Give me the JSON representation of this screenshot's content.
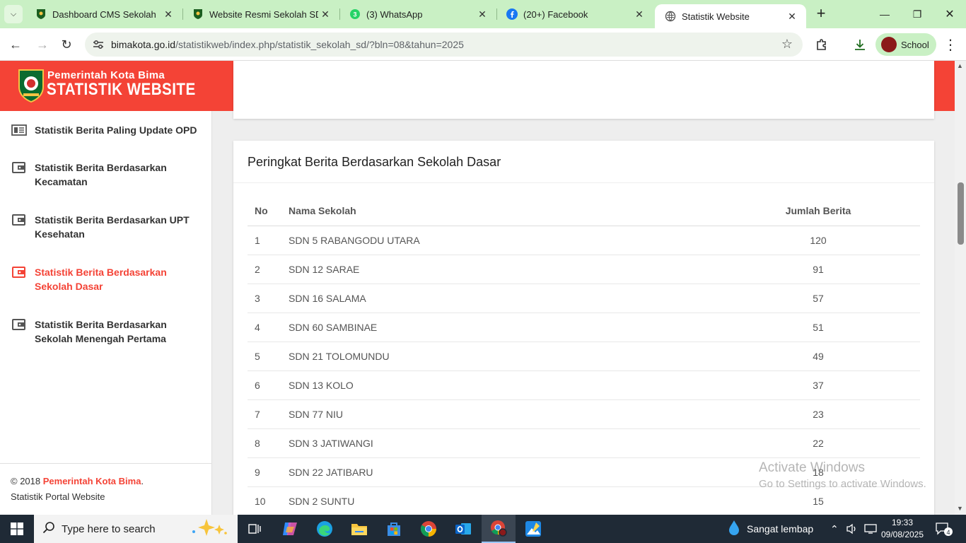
{
  "browser": {
    "tabs": [
      {
        "title": "Dashboard CMS Sekolah",
        "icon": "school-shield-icon"
      },
      {
        "title": "Website Resmi Sekolah SDN",
        "icon": "school-shield-icon"
      },
      {
        "title": "(3) WhatsApp",
        "icon": "whatsapp-icon",
        "badge": "3"
      },
      {
        "title": "(20+) Facebook",
        "icon": "facebook-icon"
      },
      {
        "title": "Statistik Website",
        "icon": "globe-icon",
        "active": true
      }
    ],
    "url_domain": "bimakota.go.id",
    "url_path": "/statistikweb/index.php/statistik_sekolah_sd/?bln=08&tahun=2025",
    "profile_name": "School"
  },
  "site": {
    "brand_top": "Pemerintah Kota Bima",
    "brand_main": "STATISTIK WEBSITE",
    "accent_color": "#f44336"
  },
  "sidebar": {
    "items": [
      {
        "label": "Statistik Berita Paling Update OPD",
        "icon": "news-icon"
      },
      {
        "label": "Statistik Berita Berdasarkan Kecamatan",
        "icon": "wallet-icon"
      },
      {
        "label": "Statistik Berita Berdasarkan UPT Kesehatan",
        "icon": "wallet-icon"
      },
      {
        "label": "Statistik Berita Berdasarkan Sekolah Dasar",
        "icon": "wallet-icon",
        "active": true
      },
      {
        "label": "Statistik Berita Berdasarkan Sekolah Menengah Pertama",
        "icon": "wallet-icon"
      }
    ],
    "footer_prefix": "© 2018 ",
    "footer_org": "Pemerintah Kota Bima",
    "footer_suffix": ".",
    "footer_line2": "Statistik Portal Website"
  },
  "ranking": {
    "title": "Peringkat Berita Berdasarkan Sekolah Dasar",
    "headers": {
      "no": "No",
      "name": "Nama Sekolah",
      "count": "Jumlah Berita"
    },
    "rows": [
      {
        "no": "1",
        "name": "SDN 5 RABANGODU UTARA",
        "count": "120"
      },
      {
        "no": "2",
        "name": "SDN 12 SARAE",
        "count": "91"
      },
      {
        "no": "3",
        "name": "SDN 16 SALAMA",
        "count": "57"
      },
      {
        "no": "4",
        "name": "SDN 60 SAMBINAE",
        "count": "51"
      },
      {
        "no": "5",
        "name": "SDN 21 TOLOMUNDU",
        "count": "49"
      },
      {
        "no": "6",
        "name": "SDN 13 KOLO",
        "count": "37"
      },
      {
        "no": "7",
        "name": "SDN 77 NIU",
        "count": "23"
      },
      {
        "no": "8",
        "name": "SDN 3 JATIWANGI",
        "count": "22"
      },
      {
        "no": "9",
        "name": "SDN 22 JATIBARU",
        "count": "18"
      },
      {
        "no": "10",
        "name": "SDN 2 SUNTU",
        "count": "15"
      }
    ]
  },
  "watermark": {
    "line1": "Activate Windows",
    "line2": "Go to Settings to activate Windows."
  },
  "taskbar": {
    "search_placeholder": "Type here to search",
    "weather": "Sangat lembap",
    "time": "19:33",
    "date": "09/08/2025",
    "notifications": "4"
  }
}
